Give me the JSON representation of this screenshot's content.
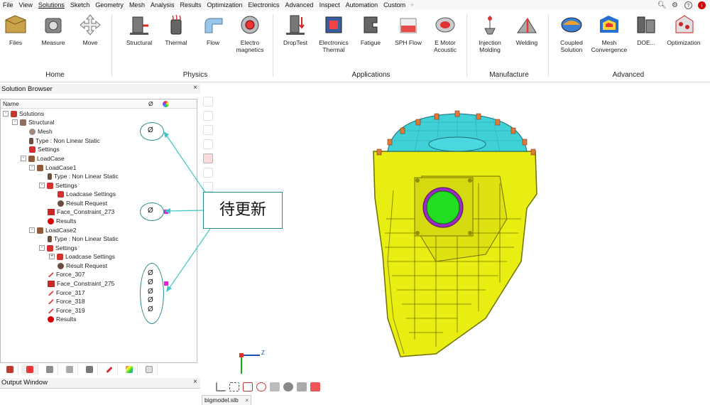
{
  "menubar": {
    "items": [
      "File",
      "View",
      "Solutions",
      "Sketch",
      "Geometry",
      "Mesh",
      "Analysis",
      "Results",
      "Optimization",
      "Electronics",
      "Advanced",
      "Inspect",
      "Automation",
      "Custom"
    ],
    "active": "Solutions",
    "add_tab": "+",
    "right_icons": [
      "search-icon",
      "settings-icon",
      "help-icon",
      "info-icon"
    ]
  },
  "ribbon": {
    "tools": [
      {
        "label": "Files",
        "icon": "files-icon"
      },
      {
        "label": "Measure",
        "icon": "measure-icon"
      },
      {
        "label": "Move",
        "icon": "move-icon"
      },
      {
        "label": "Structural",
        "icon": "structural-icon"
      },
      {
        "label": "Thermal",
        "icon": "thermal-icon"
      },
      {
        "label": "Flow",
        "icon": "flow-icon"
      },
      {
        "label": "Electro\nmagnetics",
        "icon": "electromagnetics-icon"
      },
      {
        "label": "DropTest",
        "icon": "droptest-icon"
      },
      {
        "label": "Electronics\nThermal",
        "icon": "electronics-thermal-icon"
      },
      {
        "label": "Fatigue",
        "icon": "fatigue-icon"
      },
      {
        "label": "SPH Flow",
        "icon": "sph-flow-icon"
      },
      {
        "label": "E Motor\nAcoustic",
        "icon": "e-motor-acoustic-icon"
      },
      {
        "label": "Injection\nMolding",
        "icon": "injection-molding-icon"
      },
      {
        "label": "Welding",
        "icon": "welding-icon"
      },
      {
        "label": "Coupled\nSolution",
        "icon": "coupled-solution-icon"
      },
      {
        "label": "Mesh\nConvergence",
        "icon": "mesh-convergence-icon"
      },
      {
        "label": "DOE...",
        "icon": "doe-icon"
      },
      {
        "label": "Optimization",
        "icon": "optimization-icon"
      }
    ],
    "groups": [
      "Home",
      "Physics",
      "Applications",
      "Manufacture",
      "Advanced"
    ]
  },
  "solution_browser": {
    "title": "Solution Browser",
    "close": "×",
    "columns": {
      "name": "Name",
      "phi": "Ø"
    },
    "rows": [
      {
        "label": "Solutions",
        "expander": "-"
      },
      {
        "label": "Structural",
        "expander": "-"
      },
      {
        "label": "Mesh",
        "expander": "",
        "phi": "Ø"
      },
      {
        "label": "Type : Non Linear Static",
        "expander": ""
      },
      {
        "label": "Settings",
        "expander": ""
      },
      {
        "label": "LoadCase",
        "expander": "-"
      },
      {
        "label": "LoadCase1",
        "expander": "-"
      },
      {
        "label": "Type : Non Linear Static",
        "expander": ""
      },
      {
        "label": "Settings",
        "expander": "-"
      },
      {
        "label": "Loadcase Settings",
        "expander": ""
      },
      {
        "label": "Result Request",
        "expander": ""
      },
      {
        "label": "Face_Constraint_273",
        "expander": "",
        "phi": "Ø"
      },
      {
        "label": "Results",
        "expander": ""
      },
      {
        "label": "LoadCase2",
        "expander": "-"
      },
      {
        "label": "Type : Non Linear Static",
        "expander": ""
      },
      {
        "label": "Settings",
        "expander": "-"
      },
      {
        "label": "Loadcase Settings",
        "expander": "+"
      },
      {
        "label": "Result Request",
        "expander": ""
      },
      {
        "label": "Force_307",
        "expander": "",
        "phi": "Ø"
      },
      {
        "label": "Face_Constraint_275",
        "expander": "",
        "phi": "Ø"
      },
      {
        "label": "Force_317",
        "expander": "",
        "phi": "Ø"
      },
      {
        "label": "Force_318",
        "expander": "",
        "phi": "Ø"
      },
      {
        "label": "Force_319",
        "expander": "",
        "phi": "Ø"
      },
      {
        "label": "Results",
        "expander": ""
      }
    ]
  },
  "output_window": {
    "title": "Output Window",
    "close": "×"
  },
  "viewport": {
    "callout_text": "待更新",
    "axis": {
      "x": "X",
      "z": "Z"
    },
    "colors": {
      "body": "#e8ee12",
      "dome": "#3fd0d8",
      "port": "#22dd22",
      "annotation": "#2a8c8c",
      "marker": "#e020e0"
    }
  },
  "file_tab": {
    "name": "bigmodel.slb",
    "close": "×"
  }
}
